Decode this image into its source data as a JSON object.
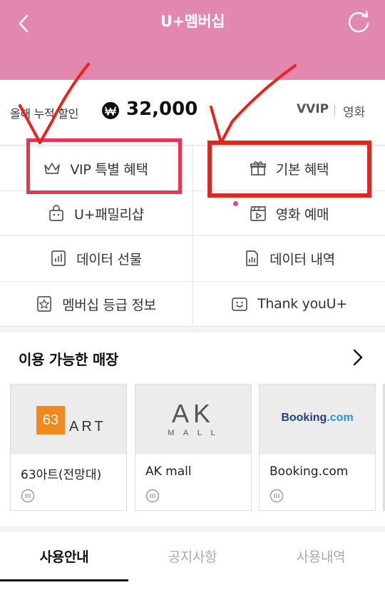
{
  "header": {
    "title": "U+멤버십"
  },
  "summary": {
    "label": "올해 누적 할인",
    "amount": "32,000",
    "grade": "VVIP",
    "genre": "영화"
  },
  "benefits": [
    {
      "label": "VIP 특별 혜택",
      "icon": "crown-icon"
    },
    {
      "label": "기본 혜택",
      "icon": "gift-icon"
    },
    {
      "label": "U+패밀리샵",
      "icon": "shopping-bag-icon"
    },
    {
      "label": "영화 예매",
      "icon": "movie-clapper-icon"
    },
    {
      "label": "데이터 선물",
      "icon": "data-gift-icon"
    },
    {
      "label": "데이터 내역",
      "icon": "data-history-icon"
    },
    {
      "label": "멤버십 등급 정보",
      "icon": "grade-star-icon"
    },
    {
      "label": "Thank youU+",
      "icon": "smile-icon"
    }
  ],
  "stores": {
    "title": "이용 가능한 매장",
    "items": [
      {
        "name": "63아트(전망대)",
        "logo_text": "63",
        "logo_sub": "ART"
      },
      {
        "name": "AK mall",
        "logo_text": "AK",
        "logo_sub": "M A L L"
      },
      {
        "name": "Booking.com",
        "logo_text": "Booking",
        "logo_sub": ".com"
      }
    ]
  },
  "tabs": [
    "사용안내",
    "공지사항",
    "사용내역"
  ],
  "colors": {
    "header": "#e287ad",
    "annotation_red": "#e8231c",
    "annotation_pink": "#f0314f"
  }
}
